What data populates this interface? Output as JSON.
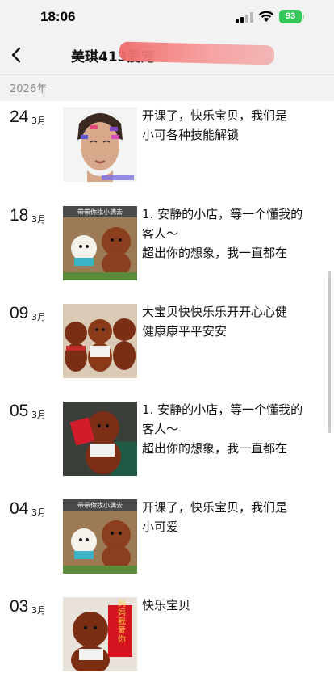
{
  "status_bar": {
    "time": "18:06",
    "battery": "93"
  },
  "nav": {
    "title": "美琪413爱宠"
  },
  "year": "2026年",
  "posts": [
    {
      "day": "24",
      "month": "3月",
      "lines": [
        "开课了，快乐宝贝，我们是",
        "小可各种技能解锁"
      ]
    },
    {
      "day": "18",
      "month": "3月",
      "lines": [
        "1. 安静的小店，等一个懂我的",
        "客人～",
        "超出你的想象，我一直都在"
      ]
    },
    {
      "day": "09",
      "month": "3月",
      "lines": [
        "大宝贝快快乐乐开开心心健",
        "健康康平平安安"
      ]
    },
    {
      "day": "05",
      "month": "3月",
      "lines": [
        "1. 安静的小店，等一个懂我的",
        "客人～",
        "超出你的想象，我一直都在"
      ]
    },
    {
      "day": "04",
      "month": "3月",
      "lines": [
        "开课了，快乐宝贝，我们是",
        "小可爱"
      ]
    },
    {
      "day": "03",
      "month": "3月",
      "lines": [
        "快乐宝贝"
      ]
    }
  ],
  "thumb_captions": {
    "find_cutie": "带带你找小满去",
    "red_card": "妈妈我爱你"
  }
}
